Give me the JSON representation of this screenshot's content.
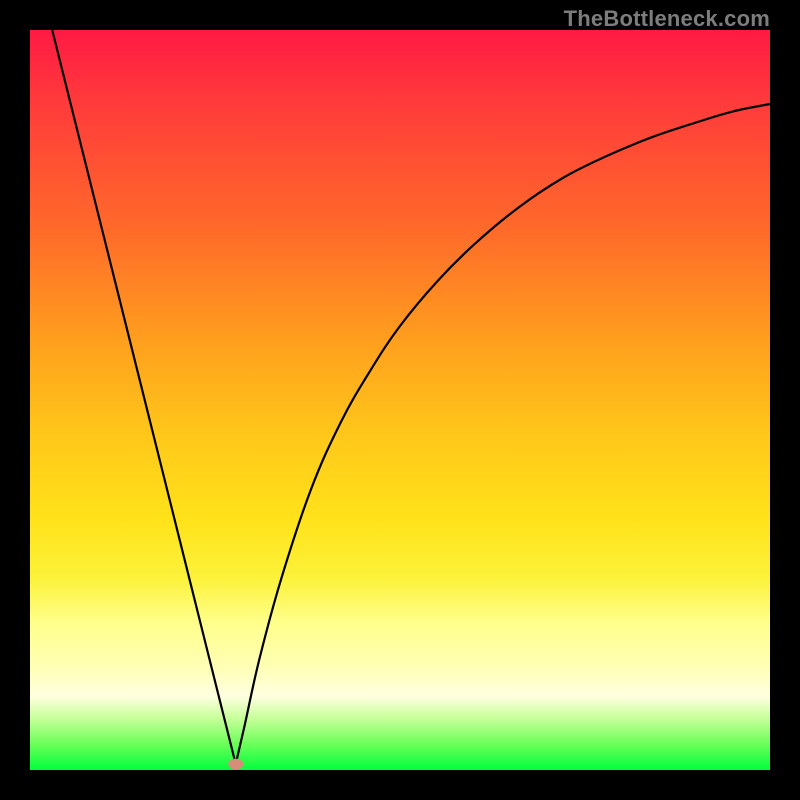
{
  "watermark": "TheBottleneck.com",
  "colors": {
    "top": "#ff1a44",
    "mid1": "#ff9f1e",
    "mid2": "#ffe21a",
    "bottom": "#00ff3c",
    "curve": "#000000",
    "marker": "#d68d7a",
    "frame": "#000000"
  },
  "chart_data": {
    "type": "line",
    "title": "",
    "xlabel": "",
    "ylabel": "",
    "xlim": [
      0,
      100
    ],
    "ylim": [
      0,
      100
    ],
    "grid": false,
    "legend": false,
    "notes": "V-shaped bottleneck curve. Left branch descends steeply and near-linearly from the top-left toward a minimum near x≈28, y≈0. Right branch rises as a concave (decelerating) curve toward the top-right, approaching y≈90 at x=100. A small salmon-colored marker sits at the minimum.",
    "series": [
      {
        "name": "left-branch",
        "x": [
          3,
          6,
          9,
          12,
          15,
          18,
          21,
          24,
          26,
          27,
          27.8
        ],
        "values": [
          100,
          88,
          76,
          64,
          52,
          40,
          28,
          16,
          8,
          4,
          0.8
        ]
      },
      {
        "name": "right-branch",
        "x": [
          27.8,
          29,
          31,
          34,
          38,
          42,
          46,
          50,
          55,
          60,
          66,
          72,
          78,
          84,
          90,
          95,
          100
        ],
        "values": [
          0.8,
          6,
          15,
          26,
          38,
          47,
          54,
          60,
          66,
          71,
          76,
          80,
          83,
          85.5,
          87.5,
          89,
          90
        ]
      }
    ],
    "marker": {
      "x": 27.8,
      "y": 0.8
    }
  }
}
